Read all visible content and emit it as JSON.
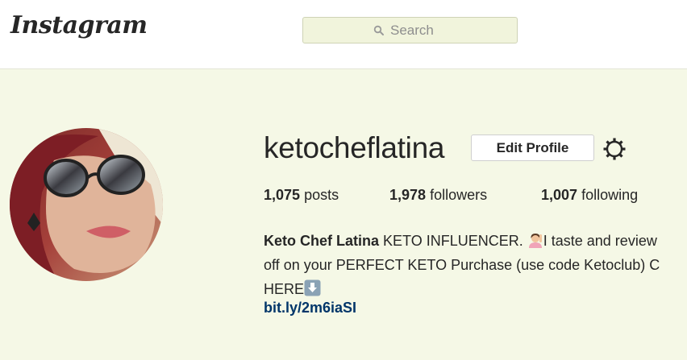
{
  "header": {
    "logo_text": "Instagram",
    "search": {
      "placeholder": "Search",
      "value": ""
    }
  },
  "profile": {
    "username": "ketocheflatina",
    "edit_profile_label": "Edit Profile",
    "stats": {
      "posts": {
        "count": "1,075",
        "label": "posts"
      },
      "followers": {
        "count": "1,978",
        "label": "followers"
      },
      "following": {
        "count": "1,007",
        "label": "following"
      }
    },
    "bio": {
      "full_name": "Keto Chef Latina",
      "line1_text": "KETO INFLUENCER.",
      "line1_after_emoji": "I taste and review",
      "line2": "off on your PERFECT KETO Purchase (use code Ketoclub) C",
      "line3": "HERE",
      "emoji_1": "woman-raising-hand-icon",
      "emoji_2": "down-arrow-icon"
    },
    "link": "bit.ly/2m6iaSI"
  },
  "colors": {
    "background": "#f5f8e6",
    "topbar": "#ffffff",
    "link": "#003569",
    "text": "#262626"
  }
}
